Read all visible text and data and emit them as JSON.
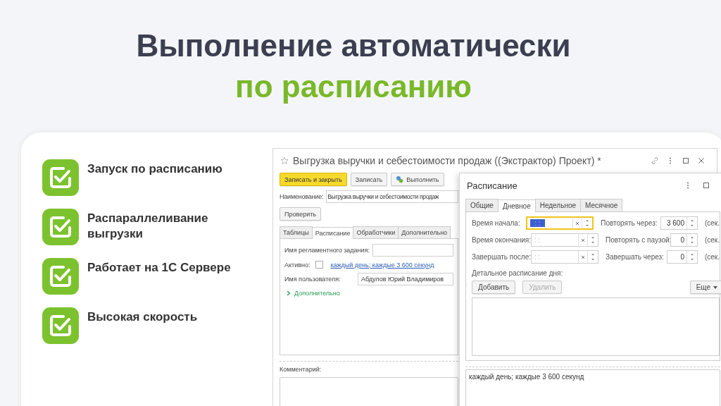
{
  "slide": {
    "title": "Выполнение автоматически",
    "subtitle": "по расписанию"
  },
  "features": [
    {
      "text": "Запуск по расписанию"
    },
    {
      "text": "Распараллеливание выгрузки"
    },
    {
      "text": "Работает на 1С Сервере"
    },
    {
      "text": "Высокая скорость"
    }
  ],
  "main_window": {
    "title": "Выгрузка выручки и себестоимости продаж ((Экстрактор) Проект) *",
    "toolbar": [
      {
        "label": "Записать и закрыть",
        "kind": "primary"
      },
      {
        "label": "Записать",
        "kind": "default"
      },
      {
        "label": "Выполнить",
        "kind": "run"
      }
    ],
    "name_label": "Наименование:",
    "name_value": "Выгрузка выручки и себестоимости продаж",
    "check_button": "Проверить",
    "tabs": [
      {
        "label": "Таблицы",
        "selected": false
      },
      {
        "label": "Расписание",
        "selected": true
      },
      {
        "label": "Обработчики",
        "selected": false
      },
      {
        "label": "Дополнительно",
        "selected": false
      }
    ],
    "task_name_label": "Имя регламентного задания:",
    "active_label": "Активно:",
    "active_checked": false,
    "schedule_link": "каждый день; каждые 3 600 секунд",
    "user_label": "Имя пользователя:",
    "user_value": "Абдулов Юрий Владимиров",
    "more_group": {
      "label": "Дополнительно",
      "expanded": false
    },
    "comment_label": "Комментарий:"
  },
  "schedule_dialog": {
    "title": "Расписание",
    "tabs": [
      {
        "label": "Общие",
        "selected": false
      },
      {
        "label": "Дневное",
        "selected": true
      },
      {
        "label": "Недельное",
        "selected": false
      },
      {
        "label": "Месячное",
        "selected": false
      }
    ],
    "rows": [
      {
        "label": "Время начала:",
        "time": ": :",
        "focused": true,
        "repeat_label": "Повторять через:",
        "repeat_value": "3 600",
        "unit": "(сек."
      },
      {
        "label": "Время окончания:",
        "time": ": :",
        "focused": false,
        "repeat_label": "Повторять с паузой:",
        "repeat_value": "0",
        "unit": "(сек."
      },
      {
        "label": "Завершать после:",
        "time": ": :",
        "focused": false,
        "repeat_label": "Завершать через:",
        "repeat_value": "0",
        "unit": "(сек."
      }
    ],
    "detail_label": "Детальное расписание дня:",
    "buttons": [
      {
        "label": "Добавить",
        "disabled": false
      },
      {
        "label": "Удалить",
        "disabled": true
      }
    ],
    "more_button": "Еще",
    "summary": "каждый день; каждые 3 600 секунд"
  }
}
